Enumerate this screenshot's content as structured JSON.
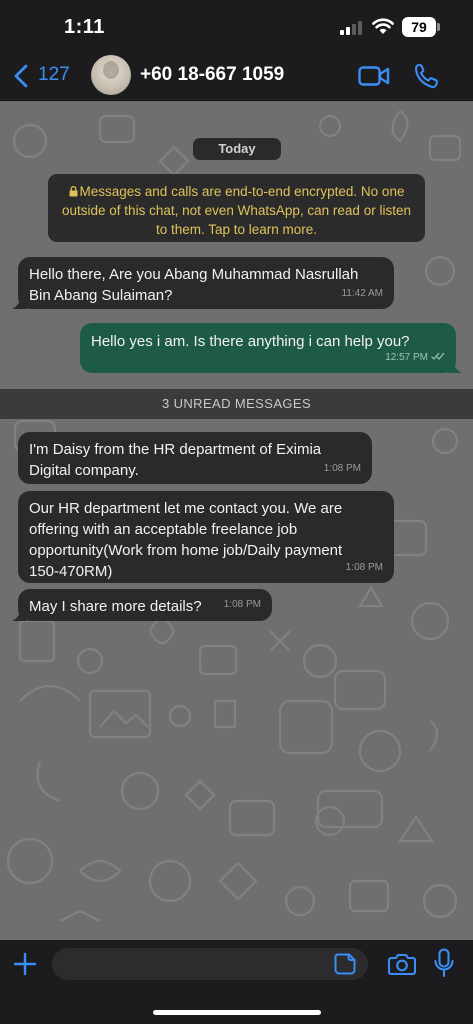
{
  "status_bar": {
    "time": "1:11",
    "battery": "79"
  },
  "header": {
    "back_count": "127",
    "contact_name": "+60 18-667 1059",
    "icons": [
      "back-chevron-icon",
      "video-call-icon",
      "voice-call-icon"
    ]
  },
  "chat": {
    "date_chip": "Today",
    "encryption_notice": "Messages and calls are end-to-end encrypted. No one outside of this chat, not even WhatsApp, can read or listen to them. Tap to learn more.",
    "unread_label": "3 UNREAD MESSAGES",
    "messages": [
      {
        "direction": "incoming",
        "lines": [
          "Hello there, Are you Abang Muhammad Nasrullah",
          "Bin Abang Sulaiman?"
        ],
        "time": "11:42 AM"
      },
      {
        "direction": "outgoing",
        "lines": [
          "Hello yes i am. Is there anything i can help you?"
        ],
        "time": "12:57 PM",
        "status": "read"
      },
      {
        "direction": "incoming",
        "lines": [
          "I'm Daisy from the HR department of Eximia",
          "Digital company."
        ],
        "time": "1:08 PM"
      },
      {
        "direction": "incoming",
        "lines": [
          "Our HR department let me contact you. We are",
          "offering with an acceptable freelance job",
          "opportunity(Work from home job/Daily payment",
          "150-470RM)"
        ],
        "time": "1:08 PM"
      },
      {
        "direction": "incoming",
        "lines": [
          "May I share more details?"
        ],
        "time": "1:08 PM"
      }
    ]
  },
  "input_bar": {
    "placeholder": "",
    "icons": [
      "plus-icon",
      "sticker-icon",
      "camera-icon",
      "microphone-icon"
    ]
  },
  "colors": {
    "accent_blue": "#3a8ef5",
    "outgoing_bubble": "#1d5a48",
    "incoming_bubble": "#2a2a2c",
    "notice_text": "#e0c25a",
    "wallpaper": "#6f6f6f"
  }
}
